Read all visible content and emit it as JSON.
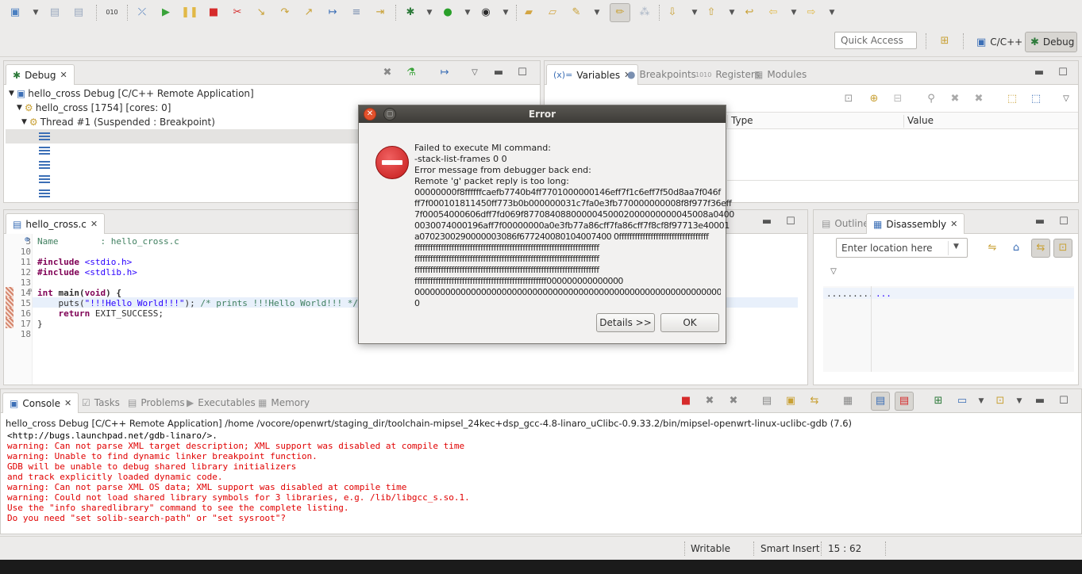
{
  "toolbar": {
    "quick_access_placeholder": "Quick Access",
    "perspectives": [
      {
        "label": "C/C++",
        "active": false
      },
      {
        "label": "Debug",
        "active": true
      }
    ]
  },
  "debug_view": {
    "tab_label": "Debug",
    "tree": [
      {
        "label": "hello_cross Debug [C/C++ Remote Application]"
      },
      {
        "label": "hello_cross [1754] [cores: 0]"
      },
      {
        "label": "Thread #1 (Suspended : Breakpoint)"
      }
    ],
    "frame_count": 6
  },
  "variables_view": {
    "tabs": [
      "Variables",
      "Breakpoints",
      "Registers",
      "Modules"
    ],
    "tab_prefixes": {
      "variables": "(x)=",
      "registers": "1010"
    },
    "columns": [
      "Type",
      "Value"
    ]
  },
  "editor": {
    "tab_label": "hello_cross.c",
    "lines": [
      {
        "n": "3",
        "text": "  Name        : hello_cross.c"
      },
      {
        "n": "10",
        "text": ""
      },
      {
        "n": "11",
        "text": "#include <stdio.h>"
      },
      {
        "n": "12",
        "text": "#include <stdlib.h>"
      },
      {
        "n": "13",
        "text": ""
      },
      {
        "n": "14",
        "text": "int main(void) {"
      },
      {
        "n": "15",
        "text": "    puts(\"!!!Hello World!!!\"); /* prints !!!Hello World!!! */"
      },
      {
        "n": "16",
        "text": "    return EXIT_SUCCESS;"
      },
      {
        "n": "17",
        "text": "}"
      },
      {
        "n": "18",
        "text": ""
      }
    ],
    "line14_parts": {
      "kw_int": "int",
      "fn": " main(",
      "kw_void": "void",
      "rest": ") {"
    },
    "line15_parts": {
      "pre": "    puts(",
      "str": "\"!!!Hello World!!!\"",
      "mid": "); ",
      "cmt": "/* prints !!!Hello World!!! */"
    },
    "line16_parts": {
      "kw": "return",
      "rest": " EXIT_SUCCESS;"
    },
    "include_kw": "#include",
    "include1": " <stdio.h>",
    "include2": " <stdlib.h>",
    "header_comment": "Name        : hello_cross.c"
  },
  "disassembly_view": {
    "tabs": [
      "Outline",
      "Disassembly"
    ],
    "location_placeholder": "Enter location here",
    "dots_left": ".........",
    "dots_right": "..."
  },
  "console_view": {
    "tabs": [
      "Console",
      "Tasks",
      "Problems",
      "Executables",
      "Memory"
    ],
    "header": "hello_cross Debug [C/C++ Remote Application] /home /vocore/openwrt/staging_dir/toolchain-mipsel_24kec+dsp_gcc-4.8-linaro_uClibc-0.9.33.2/bin/mipsel-openwrt-linux-uclibc-gdb (7.6)",
    "lines": [
      {
        "text": "<http://bugs.launchpad.net/gdb-linaro/>.",
        "color": "#000000"
      },
      {
        "text": "warning: Can not parse XML target description; XML support was disabled at compile time",
        "color": "#e00000"
      },
      {
        "text": "warning: Unable to find dynamic linker breakpoint function.",
        "color": "#e00000"
      },
      {
        "text": "GDB will be unable to debug shared library initializers",
        "color": "#e00000"
      },
      {
        "text": "and track explicitly loaded dynamic code.",
        "color": "#e00000"
      },
      {
        "text": "warning: Can not parse XML OS data; XML support was disabled at compile time",
        "color": "#e00000"
      },
      {
        "text": "warning: Could not load shared library symbols for 3 libraries, e.g. /lib/libgcc_s.so.1.",
        "color": "#e00000"
      },
      {
        "text": "Use the \"info sharedlibrary\" command to see the complete listing.",
        "color": "#e00000"
      },
      {
        "text": "Do you need \"set solib-search-path\" or \"set sysroot\"?",
        "color": "#e00000"
      }
    ]
  },
  "error_dialog": {
    "title": "Error",
    "message_lines": [
      "Failed to execute MI command:",
      "-stack-list-frames 0 0",
      "Error message from debugger back end:",
      "Remote 'g' packet reply is too long:",
      "00000000f8ffffffcaefb7740b4ff7701000000146eff7f1c6eff7f50d8aa7f046f",
      "ff7f000101811450ff773b0b000000031c7fa0e3fb770000000008f8f977f36eff",
      "7f00054000606dff7fd069f87708408800000450002000000000045008a0400",
      "0030074000196aff7f00000000a0e3fb77a86cff7fa86cff7f8cf8f97713e40001",
      "a0702300290000003086f677240080104007400 0ffffffffffffffffffffffffffffffffff",
      "ffffffffffffffffffffffffffffffffffffffffffffffffffffffffffffffffffffff",
      "ffffffffffffffffffffffffffffffffffffffffffffffffffffffffffffffffffffff",
      "ffffffffffffffffffffffffffffffffffffffffffffffffffffffffffffffffffffff",
      "ffffffffffffffffffffffffffffffffffffffffffffffffff000000000000000",
      "0000000000000000000000000000000000000000000000000000000000000000",
      "0"
    ],
    "details_label": "Details >>",
    "ok_label": "OK"
  },
  "status_bar": {
    "mode": "Writable",
    "insert": "Smart Insert",
    "position": "15 : 62"
  }
}
